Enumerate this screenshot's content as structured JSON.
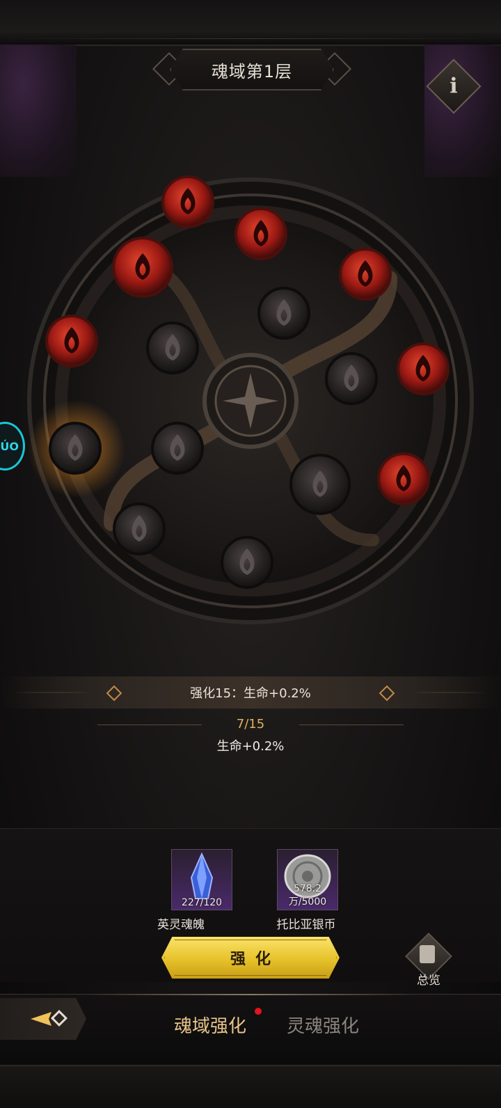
{
  "header": {
    "title": "魂域第1层",
    "info_icon": "info-icon"
  },
  "side_badge": {
    "text": "ÚO"
  },
  "wheel": {
    "center_icon": "spiral-star-icon",
    "nodes": [
      {
        "state": "unlocked",
        "icon": "flame-icon"
      },
      {
        "state": "unlocked",
        "icon": "flame-icon"
      },
      {
        "state": "unlocked",
        "icon": "flame-icon"
      },
      {
        "state": "unlocked",
        "icon": "flame-icon"
      },
      {
        "state": "unlocked",
        "icon": "flame-icon"
      },
      {
        "state": "unlocked",
        "icon": "flame-icon"
      },
      {
        "state": "unlocked",
        "icon": "flame-icon"
      },
      {
        "state": "locked",
        "icon": "flame-icon"
      },
      {
        "state": "locked",
        "icon": "flame-icon"
      },
      {
        "state": "locked",
        "icon": "flame-icon"
      },
      {
        "state": "locked",
        "icon": "flame-icon"
      },
      {
        "state": "locked",
        "icon": "flame-icon"
      },
      {
        "state": "locked",
        "icon": "flame-icon"
      },
      {
        "state": "locked",
        "icon": "flame-icon"
      },
      {
        "state": "locked",
        "icon": "flame-icon"
      }
    ],
    "colors": {
      "unlocked": "#b3201a",
      "locked": "#2a2626",
      "ring": "#3d3631"
    }
  },
  "detail": {
    "title": "强化15：生命+0.2%",
    "progress": "7/15",
    "bonus": "生命+0.2%"
  },
  "cost": {
    "items": [
      {
        "name": "英灵魂魄",
        "count": "227/120",
        "icon": "blue-crystal-icon"
      },
      {
        "name": "托比亚银币",
        "count": "578.2万/5000",
        "icon": "silver-coin-icon"
      }
    ]
  },
  "actions": {
    "upgrade_label": "强化",
    "overview_label": "总览"
  },
  "tabs": [
    {
      "label": "魂域强化",
      "active": true,
      "has_dot": true
    },
    {
      "label": "灵魂强化",
      "active": false
    }
  ],
  "colors": {
    "gold_button": "#e6c22a",
    "accent_text": "#e0b15c",
    "active_tab": "#e8c48a",
    "inactive_tab": "#8b8580",
    "notify_dot": "#e0151e"
  }
}
